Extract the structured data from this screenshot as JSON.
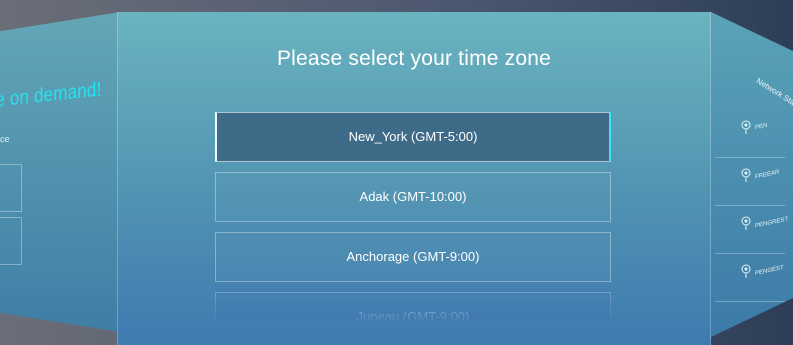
{
  "left_panel": {
    "headline": "e on demand!",
    "subtext": "ce"
  },
  "main": {
    "title": "Please select your time zone",
    "timezones": [
      {
        "label": "New_York  (GMT-5:00)",
        "selected": true
      },
      {
        "label": "Adak  (GMT-10:00)",
        "selected": false
      },
      {
        "label": "Anchorage  (GMT-9:00)",
        "selected": false
      },
      {
        "label": "Juneau  (GMT-9:00)",
        "selected": false
      }
    ]
  },
  "right_panel": {
    "title": "Network Status",
    "networks": [
      {
        "label": "PEN",
        "icon": "wifi-icon"
      },
      {
        "label": "FREEAR",
        "icon": "wifi-icon"
      },
      {
        "label": "PENGREST",
        "icon": "wifi-icon"
      },
      {
        "label": "PENGEST",
        "icon": "wifi-icon"
      }
    ]
  },
  "colors": {
    "accent_cyan": "#24e3f0",
    "selected_bg": "#3e6c88",
    "panel_top": "#6ab4c0",
    "panel_bottom": "#3f7ab0"
  }
}
